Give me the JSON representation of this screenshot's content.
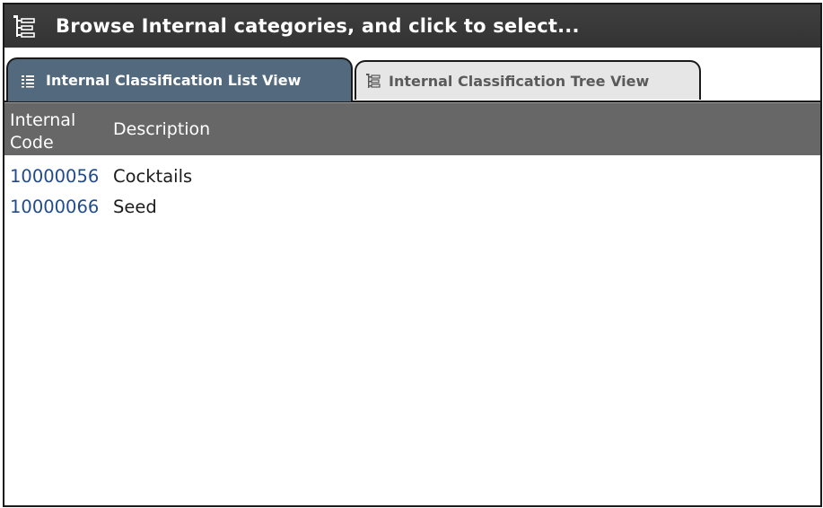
{
  "window": {
    "title": "Browse Internal categories, and click to select...",
    "title_icon": "tree-outline-icon"
  },
  "tabs": [
    {
      "label": "Internal Classification List View",
      "icon": "list-icon",
      "active": true
    },
    {
      "label": "Internal Classification Tree View",
      "icon": "tree-icon",
      "active": false
    }
  ],
  "table": {
    "columns": [
      "Internal Code",
      "Description"
    ],
    "rows": [
      {
        "code": "10000056",
        "description": "Cocktails"
      },
      {
        "code": "10000066",
        "description": "Seed"
      }
    ]
  },
  "colors": {
    "title_bar": "#3a3a3a",
    "active_tab": "#53697e",
    "inactive_tab": "#e6e6e6",
    "table_header": "#676767",
    "code_text": "#1f4b8e"
  }
}
